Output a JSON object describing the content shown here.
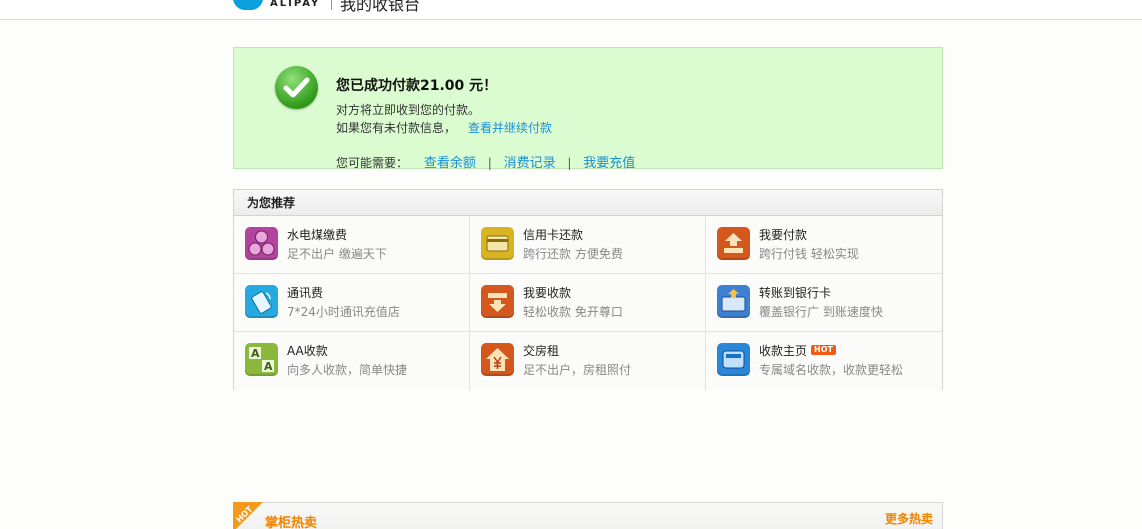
{
  "header": {
    "logo_text": "ALIPAY",
    "site_title": "我的收银台"
  },
  "success": {
    "title": "您已成功付款21.00 元！",
    "line1": "对方将立即收到您的付款。",
    "line2_prefix": "如果您有未付款信息，",
    "line2_link": "查看并继续付款",
    "need_label": "您可能需要：",
    "need_links": [
      "查看余额",
      "消费记录",
      "我要充值"
    ],
    "separator": "|"
  },
  "recommend": {
    "title": "为您推荐",
    "items": [
      {
        "name": "水电煤缴费",
        "desc": "足不出户  缴遍天下",
        "icon": "utility-bill-icon",
        "color": "#b2449e"
      },
      {
        "name": "信用卡还款",
        "desc": "跨行还款  方便免费",
        "icon": "credit-card-icon",
        "color": "#d9b422"
      },
      {
        "name": "我要付款",
        "desc": "跨行付钱  轻松实现",
        "icon": "pay-box-icon",
        "color": "#d4581e"
      },
      {
        "name": "通讯费",
        "desc": "7*24小时通讯充值店",
        "icon": "mobile-phone-icon",
        "color": "#26a9e0"
      },
      {
        "name": "我要收款",
        "desc": "轻松收款  免开尊口",
        "icon": "receive-box-icon",
        "color": "#d4581e"
      },
      {
        "name": "转账到银行卡",
        "desc": "覆盖银行广  到账速度快",
        "icon": "bank-card-icon",
        "color": "#3d7fd0"
      },
      {
        "name": "AA收款",
        "desc": "向多人收款，简单快捷",
        "icon": "aa-split-icon",
        "color": "#8ab83a"
      },
      {
        "name": "交房租",
        "desc": "足不出户，房租照付",
        "icon": "house-rent-icon",
        "color": "#d4581e"
      },
      {
        "name": "收款主页",
        "desc": "专属域名收款，收款更轻松",
        "icon": "homepage-icon",
        "color": "#2a86d8",
        "badge": "HOT"
      }
    ]
  },
  "hot": {
    "corner": "HOT",
    "title": "掌柜热卖",
    "more": "更多热卖"
  }
}
